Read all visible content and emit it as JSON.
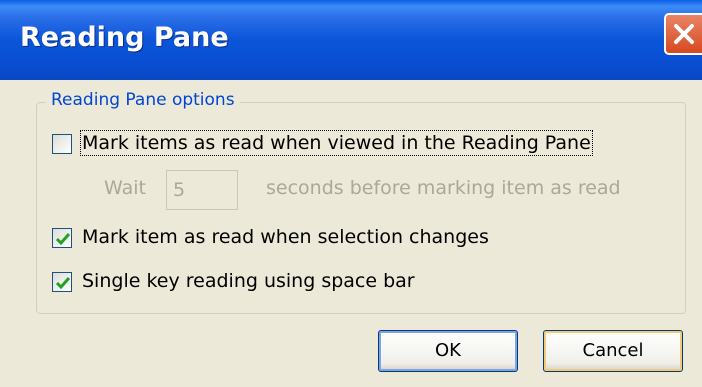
{
  "dialog": {
    "title": "Reading Pane",
    "group_label": "Reading Pane options",
    "options": [
      {
        "label": "Mark items as read when viewed in the Reading Pane",
        "checked": false
      },
      {
        "label": "Mark item as read when selection changes",
        "checked": true
      },
      {
        "label": "Single key reading using space bar",
        "checked": true
      }
    ],
    "wait": {
      "label": "Wait",
      "value": "5",
      "suffix": "seconds before marking item as read"
    },
    "buttons": {
      "ok": "OK",
      "cancel": "Cancel"
    }
  },
  "colors": {
    "titlebar": "#0A4FD3",
    "close": "#D64A20",
    "background": "#ECE9D8",
    "group_label": "#0046D5"
  }
}
